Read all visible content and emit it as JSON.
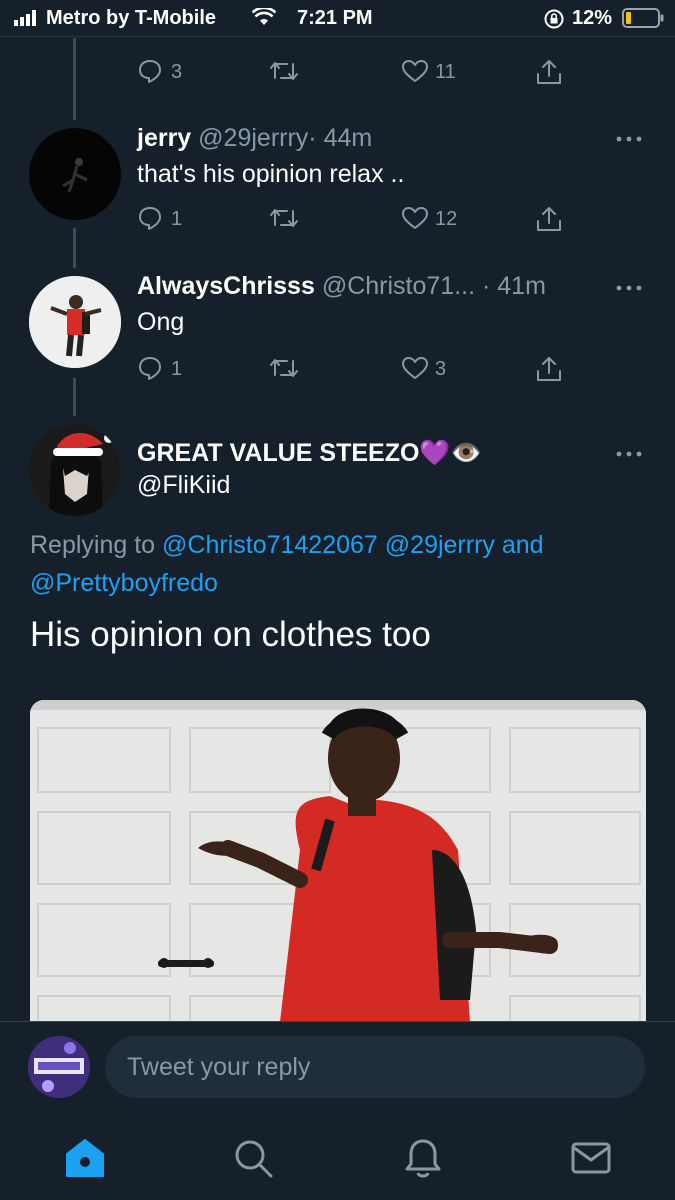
{
  "status_bar": {
    "carrier": "Metro by T-Mobile",
    "time": "7:21 PM",
    "battery": "12%"
  },
  "previous_tweet": {
    "counts": {
      "replies": "3",
      "retweets": "",
      "likes": "11"
    }
  },
  "tweets": [
    {
      "name": "jerry",
      "handle": "@29jerrry",
      "time": "· 44m",
      "text": "that's his opinion relax ..",
      "counts": {
        "replies": "1",
        "retweets": "",
        "likes": "12"
      }
    },
    {
      "name": "AlwaysChrisss",
      "handle": "@Christo71...",
      "time": "· 41m",
      "text": "Ong",
      "counts": {
        "replies": "1",
        "retweets": "",
        "likes": "3"
      }
    }
  ],
  "focused_tweet": {
    "name": "GREAT VALUE STEEZO",
    "name_emoji": "💜👁️",
    "handle": "@FliKiid",
    "replying_prefix": "Replying to",
    "mention_1": "@Christo71422067",
    "mention_2": "@29jerrry",
    "and_word": "and",
    "mention_3": "@Prettyboyfredo",
    "text": "His opinion on clothes too"
  },
  "composer": {
    "placeholder": "Tweet your reply"
  },
  "tabs": [
    "home-icon",
    "search-icon",
    "notifications-icon",
    "messages-icon"
  ],
  "colors": {
    "background": "#15202b",
    "accent": "#1da1f2",
    "muted": "#8899a6"
  }
}
